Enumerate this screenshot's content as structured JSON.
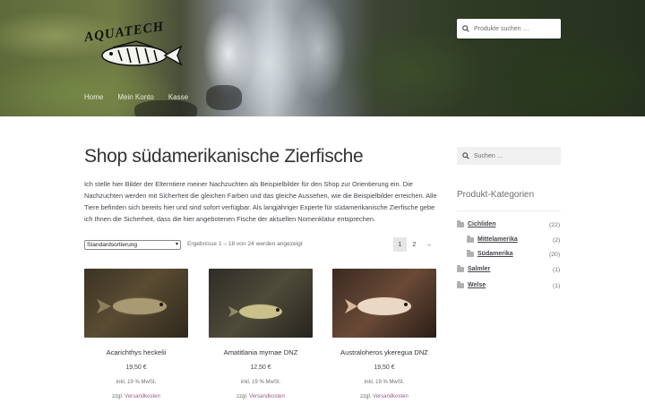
{
  "header": {
    "logo_text": "AQUATECH",
    "nav": [
      "Home",
      "Mein Konto",
      "Kasse"
    ],
    "search_placeholder": "Produkte suchen …"
  },
  "main": {
    "title": "Shop südamerikanische Zierfische",
    "intro": "Ich stelle hier Bilder der Elterntiere meiner Nachzuchten als Beispielbilder für den Shop zur Orientierung ein. Die Nachzuchten werden mit Sicherheit die gleichen Farben und das gleiche Aussehen, wie die Beispielbilder erreichen. Alle Tiere befinden sich bereits hier und sind sofort verfügbar. Als langjähriger Experte für südamerikanische Zierfische gebe ich Ihnen die Sicherheit, dass die hier angebotenen Fische der aktuellen Nomenklatur entsprechen.",
    "sort_selected": "Standardsortierung",
    "result_count": "Ergebnisse 1 – 18 von 24 werden angezeigt",
    "pagination": [
      "1",
      "2",
      "→"
    ]
  },
  "products": [
    {
      "name": "Acarichthys heckelii",
      "price": "19,50 €",
      "tax": "inkl. 19 % MwSt.",
      "ship_prefix": "zzgl.",
      "ship_link": "Versandkosten"
    },
    {
      "name": "Amatitlania myrnae DNZ",
      "price": "12,50 €",
      "tax": "inkl. 19 % MwSt.",
      "ship_prefix": "zzgl.",
      "ship_link": "Versandkosten"
    },
    {
      "name": "Australoheros ykeregua DNZ",
      "price": "19,50 €",
      "tax": "inkl. 19 % MwSt.",
      "ship_prefix": "zzgl.",
      "ship_link": "Versandkosten"
    }
  ],
  "sidebar": {
    "search_placeholder": "Suchen …",
    "heading": "Produkt-Kategorien",
    "categories": [
      {
        "label": "Cichliden",
        "count": "(22)"
      },
      {
        "label": "Mittelamerika",
        "count": "(2)"
      },
      {
        "label": "Südamerika",
        "count": "(20)"
      },
      {
        "label": "Salmler",
        "count": "(1)"
      },
      {
        "label": "Welse",
        "count": "(1)"
      }
    ]
  },
  "colors": {
    "link": "#96588a",
    "text": "#43454b",
    "sidebar_bg": "#f0f0f0"
  }
}
